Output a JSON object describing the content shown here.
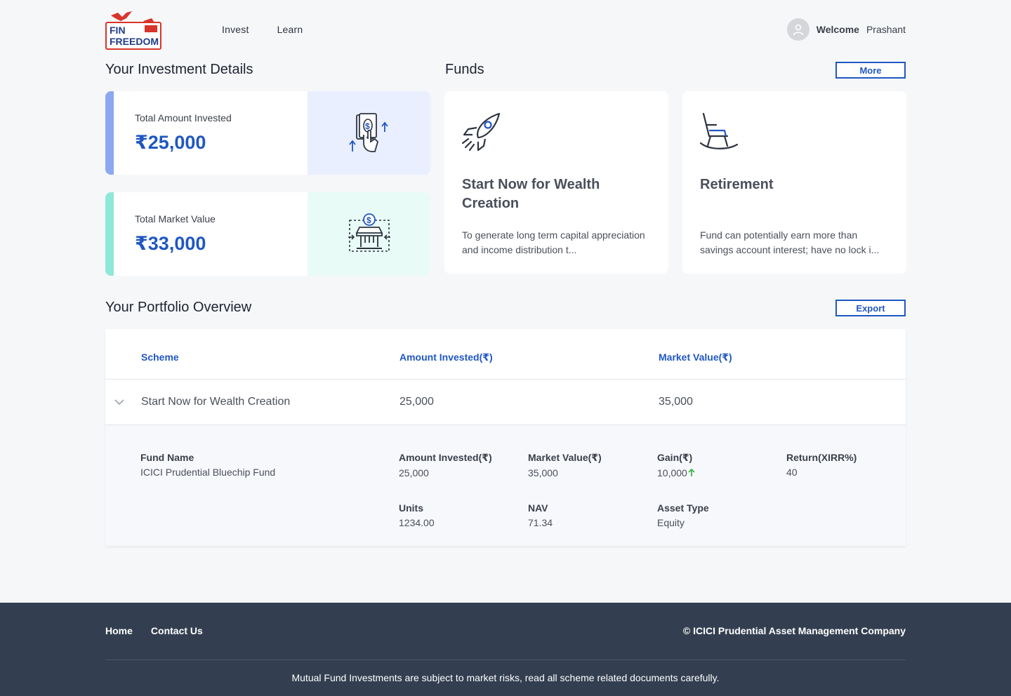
{
  "header": {
    "logo_line1": "FIN",
    "logo_line2": "FREEDOM",
    "nav": [
      {
        "label": "Invest"
      },
      {
        "label": "Learn"
      }
    ],
    "welcome_label": "Welcome",
    "user_name": "Prashant"
  },
  "investment": {
    "title": "Your Investment Details",
    "cards": [
      {
        "label": "Total Amount Invested",
        "value": "₹25,000",
        "accent": "#8ba8f0",
        "panel": "#e9efff",
        "icon": "money-hand-icon"
      },
      {
        "label": "Total Market Value",
        "value": "₹33,000",
        "accent": "#8ee8d8",
        "panel": "#e9fbf6",
        "icon": "market-stall-icon"
      }
    ]
  },
  "funds": {
    "title": "Funds",
    "more_label": "More",
    "cards": [
      {
        "title": "Start Now for Wealth Creation",
        "desc": "To generate long term capital appreciation and income distribution t...",
        "icon": "rocket-icon"
      },
      {
        "title": "Retirement",
        "desc": "Fund can potentially earn more than savings account interest; have no lock i...",
        "icon": "rocking-chair-icon"
      }
    ]
  },
  "portfolio": {
    "title": "Your Portfolio Overview",
    "export_label": "Export",
    "columns": [
      "Scheme",
      "Amount Invested(₹)",
      "Market Value(₹)"
    ],
    "row": {
      "scheme": "Start Now for Wealth Creation",
      "invested": "25,000",
      "market": "35,000"
    },
    "details": {
      "fund_name_label": "Fund Name",
      "fund_name": "ICICI Prudential Bluechip Fund",
      "invested_label": "Amount Invested(₹)",
      "invested": "25,000",
      "market_label": "Market Value(₹)",
      "market": "35,000",
      "gain_label": "Gain(₹)",
      "gain": "10,000",
      "return_label": "Return(XIRR%)",
      "return": "40",
      "units_label": "Units",
      "units": "1234.00",
      "nav_label": "NAV",
      "nav": "71.34",
      "asset_label": "Asset Type",
      "asset": "Equity"
    }
  },
  "footer": {
    "links": [
      {
        "label": "Home"
      },
      {
        "label": "Contact Us"
      }
    ],
    "copyright": "© ICICI Prudential Asset Management Company",
    "disclaimer": "Mutual Fund Investments are subject to market risks, read all scheme related documents carefully."
  },
  "colors": {
    "accent": "#1f57c3",
    "footer": "#333f51",
    "gain_up": "#3bb54a"
  }
}
